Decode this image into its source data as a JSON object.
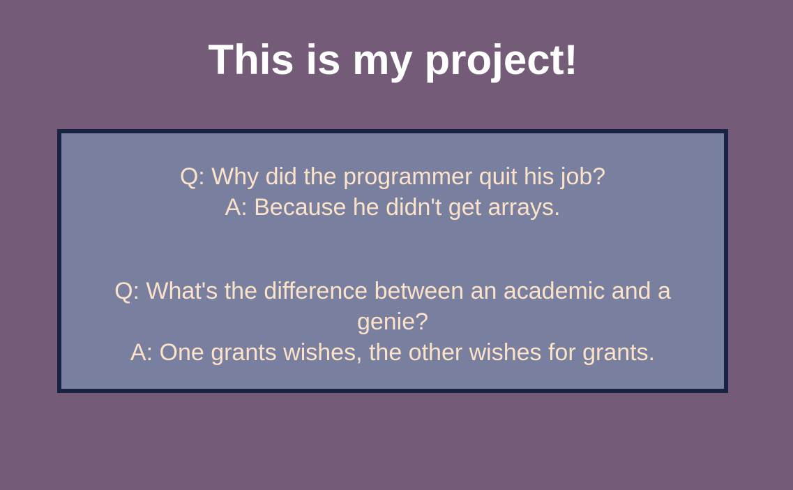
{
  "page": {
    "title": "This is my project!"
  },
  "jokes": [
    {
      "question": "Q: Why did the programmer quit his job?",
      "answer": "A: Because he didn't get arrays."
    },
    {
      "question": "Q: What's the difference between an academic and a genie?",
      "answer": "A: One grants wishes, the other wishes for grants."
    }
  ],
  "colors": {
    "background": "#745c78",
    "card": "#787f9f",
    "card_border": "#172341",
    "title": "#ffffff",
    "joke_text": "#fbe2c8"
  }
}
